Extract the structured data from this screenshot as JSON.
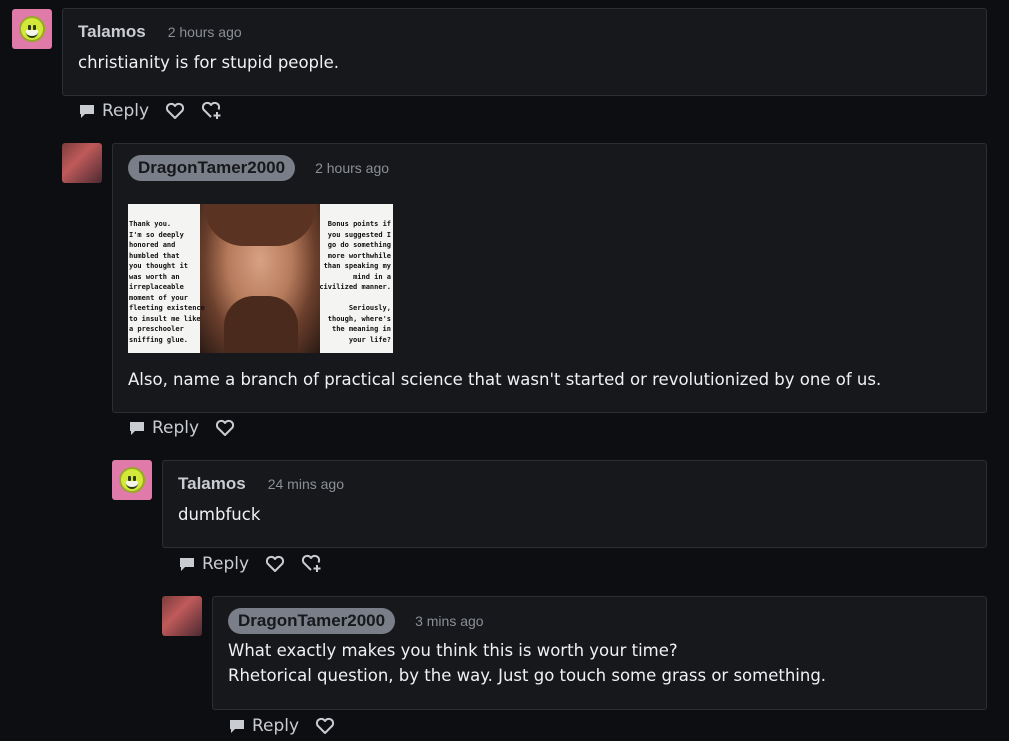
{
  "reply_label": "Reply",
  "comments": [
    {
      "username": "Talamos",
      "time": "2 hours ago",
      "text": "christianity is for stupid people."
    },
    {
      "username": "DragonTamer2000",
      "time": "2 hours ago",
      "image": {
        "left_text": "Thank you.\nI'm so deeply\nhonored and\nhumbled that\nyou thought it\nwas worth an\nirreplaceable\nmoment of your\nfleeting existence\nto insult me like\na preschooler\nsniffing glue.",
        "right_text": "Bonus points if\nyou suggested I\ngo do something\nmore worthwhile\nthan speaking my\nmind in a\ncivilized manner.\n\nSeriously,\nthough, where's\nthe meaning in\nyour life?"
      },
      "text": "Also, name a branch of practical science that wasn't started or revolutionized by one of us."
    },
    {
      "username": "Talamos",
      "time": "24 mins ago",
      "text": "dumbfuck"
    },
    {
      "username": "DragonTamer2000",
      "time": "3 mins ago",
      "line1": "What exactly makes you think this is worth your time?",
      "line2": "Rhetorical question, by the way. Just go touch some grass or something."
    }
  ],
  "colors": {
    "background": "#0d0e11",
    "card": "#16181c",
    "border": "#2b2e33",
    "pill": "#7a7e88"
  }
}
